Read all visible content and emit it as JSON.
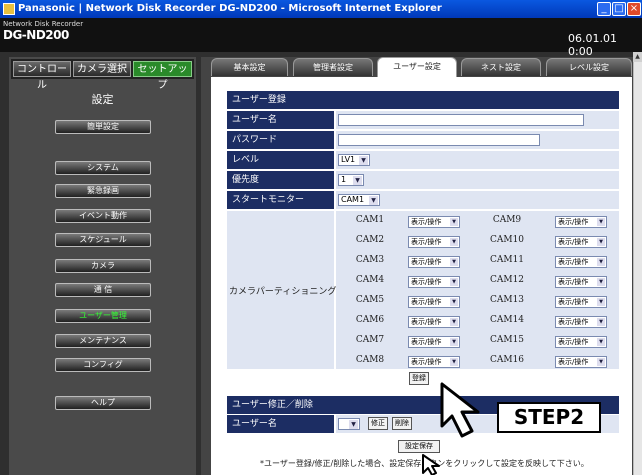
{
  "window": {
    "title": "Panasonic | Network Disk Recorder DG-ND200 - Microsoft Internet Explorer",
    "min": "_",
    "max": "□",
    "close": "×"
  },
  "header": {
    "product_small": "Network Disk Recorder",
    "product_big": "DG-ND200",
    "clock": "06.01.01  0:00"
  },
  "top_buttons": [
    "コントロール",
    "カメラ選択",
    "セットアップ"
  ],
  "nav": {
    "title": "設定",
    "items": [
      "簡単設定",
      "システム",
      "緊急録画",
      "イベント動作",
      "スケジュール",
      "カメラ",
      "通 信",
      "ユーザー管理",
      "メンテナンス",
      "コンフィグ",
      "ヘルプ"
    ],
    "active": "ユーザー管理"
  },
  "tabs": [
    "基本設定",
    "管理者設定",
    "ユーザー設定",
    "ネスト設定",
    "レベル設定"
  ],
  "active_tab": "ユーザー設定",
  "user_registration": {
    "header": "ユーザー登録",
    "username_label": "ユーザー名",
    "password_label": "パスワード",
    "level_label": "レベル",
    "level_value": "LV1",
    "priority_label": "優先度",
    "priority_value": "1",
    "start_monitor_label": "スタートモニター",
    "start_monitor_value": "CAM1",
    "camera_partitioning_label": "カメラパーティショニング",
    "cameras_left": [
      {
        "cam": "CAM1",
        "value": "表示/操作"
      },
      {
        "cam": "CAM2",
        "value": "表示/操作"
      },
      {
        "cam": "CAM3",
        "value": "表示/操作"
      },
      {
        "cam": "CAM4",
        "value": "表示/操作"
      },
      {
        "cam": "CAM5",
        "value": "表示/操作"
      },
      {
        "cam": "CAM6",
        "value": "表示/操作"
      },
      {
        "cam": "CAM7",
        "value": "表示/操作"
      },
      {
        "cam": "CAM8",
        "value": "表示/操作"
      }
    ],
    "cameras_right": [
      {
        "cam": "CAM9",
        "value": "表示/操作"
      },
      {
        "cam": "CAM10",
        "value": "表示/操作"
      },
      {
        "cam": "CAM11",
        "value": "表示/操作"
      },
      {
        "cam": "CAM12",
        "value": "表示/操作"
      },
      {
        "cam": "CAM13",
        "value": "表示/操作"
      },
      {
        "cam": "CAM14",
        "value": "表示/操作"
      },
      {
        "cam": "CAM15",
        "value": "表示/操作"
      },
      {
        "cam": "CAM16",
        "value": "表示/操作"
      }
    ],
    "register_button": "登録"
  },
  "user_edit": {
    "header": "ユーザー修正／削除",
    "username_label": "ユーザー名",
    "edit_button": "修正",
    "delete_button": "削除"
  },
  "save_button": "設定保存",
  "note": "*ユーザー登録/修正/削除した場合、設定保存ボタンをクリックして設定を反映して下さい。",
  "callout": "STEP2",
  "icons": {
    "arrow": "down-chevron-icon",
    "cursor": "pointer-cursor-icon"
  },
  "colors": {
    "titlebar": "#0a58e0",
    "form_label_bg": "#1c2d63",
    "form_cell_bg": "#dfe5f2",
    "active_tab_green": "#2a8a2a",
    "active_nav_text": "#33ff33"
  }
}
